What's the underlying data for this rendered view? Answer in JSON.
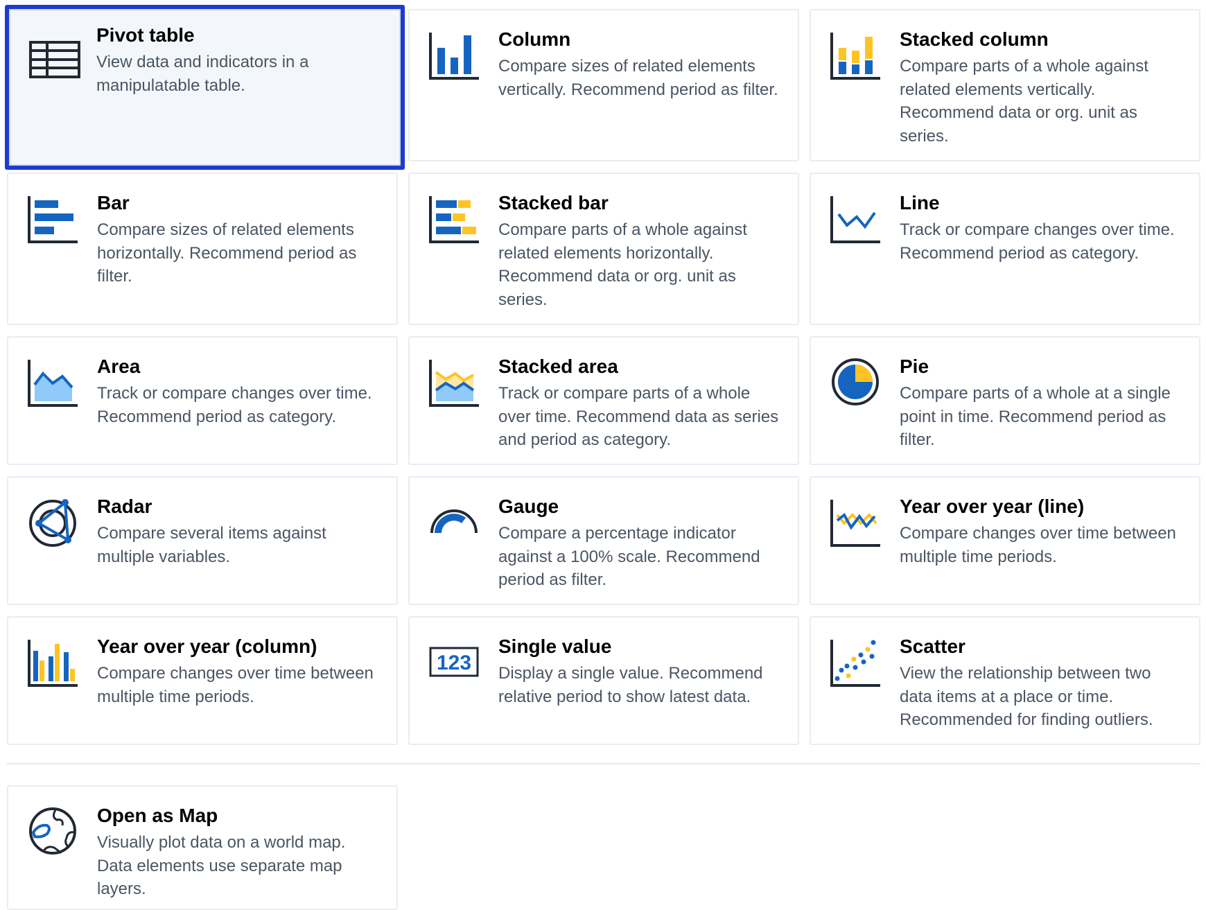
{
  "colors": {
    "accent_blue": "#1565c0",
    "accent_yellow": "#ffc324",
    "ink": "#212934",
    "selection_border": "#1f3ad1"
  },
  "selected_item": "pivot-table",
  "items": [
    {
      "icon": "pivot-table-icon",
      "title": "Pivot table",
      "description": "View data and indicators in a manipulatable table."
    },
    {
      "icon": "column-chart-icon",
      "title": "Column",
      "description": "Compare sizes of related elements vertically. Recommend period as filter."
    },
    {
      "icon": "stacked-column-chart-icon",
      "title": "Stacked column",
      "description": "Compare parts of a whole against related elements vertically. Recommend data or org. unit as series."
    },
    {
      "icon": "bar-chart-icon",
      "title": "Bar",
      "description": "Compare sizes of related elements horizontally. Recommend period as filter."
    },
    {
      "icon": "stacked-bar-chart-icon",
      "title": "Stacked bar",
      "description": "Compare parts of a whole against related elements horizontally. Recommend data or org. unit as series."
    },
    {
      "icon": "line-chart-icon",
      "title": "Line",
      "description": "Track or compare changes over time. Recommend period as category."
    },
    {
      "icon": "area-chart-icon",
      "title": "Area",
      "description": "Track or compare changes over time. Recommend period as category."
    },
    {
      "icon": "stacked-area-chart-icon",
      "title": "Stacked area",
      "description": "Track or compare parts of a whole over time. Recommend data as series and period as category."
    },
    {
      "icon": "pie-chart-icon",
      "title": "Pie",
      "description": "Compare parts of a whole at a single point in time. Recommend period as filter."
    },
    {
      "icon": "radar-chart-icon",
      "title": "Radar",
      "description": "Compare several items against multiple variables."
    },
    {
      "icon": "gauge-chart-icon",
      "title": "Gauge",
      "description": "Compare a percentage indicator against a 100% scale. Recommend period as filter."
    },
    {
      "icon": "year-over-year-line-icon",
      "title": "Year over year (line)",
      "description": "Compare changes over time between multiple time periods."
    },
    {
      "icon": "year-over-year-column-icon",
      "title": "Year over year (column)",
      "description": "Compare changes over time between multiple time periods."
    },
    {
      "icon": "single-value-icon",
      "title": "Single value",
      "description": "Display a single value. Recommend relative period to show latest data.",
      "icon_text": "123"
    },
    {
      "icon": "scatter-chart-icon",
      "title": "Scatter",
      "description": "View the relationship between two data items at a place or time. Recommended for finding outliers."
    }
  ],
  "map_option": {
    "icon": "globe-map-icon",
    "title": "Open as Map",
    "description": "Visually plot data on a world map. Data elements use separate map layers."
  }
}
